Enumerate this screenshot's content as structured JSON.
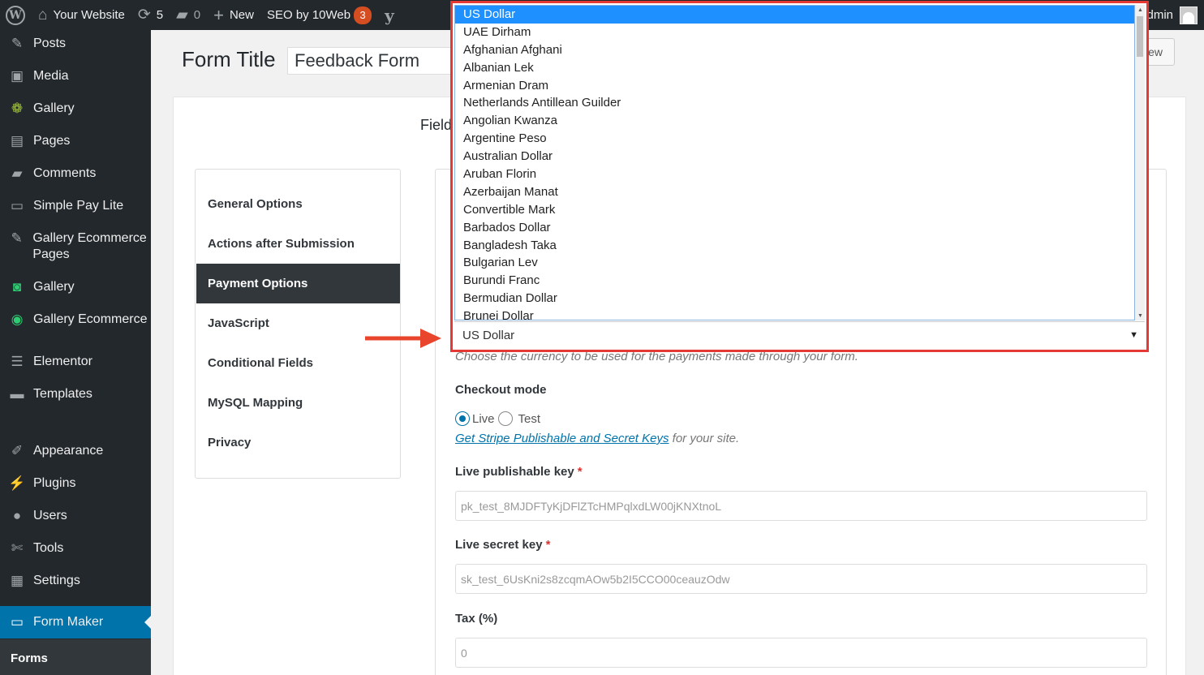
{
  "adminbar": {
    "site_name": "Your Website",
    "updates_count": "5",
    "comments_count": "0",
    "new_label": "New",
    "seo_label": "SEO by 10Web",
    "seo_badge": "3",
    "account_text": "dmin"
  },
  "sidebar": {
    "items": [
      {
        "label": "Posts",
        "icon": "pin-icon"
      },
      {
        "label": "Media",
        "icon": "media-icon"
      },
      {
        "label": "Gallery",
        "icon": "gallery-icon"
      },
      {
        "label": "Pages",
        "icon": "pages-icon"
      },
      {
        "label": "Comments",
        "icon": "comments-icon"
      },
      {
        "label": "Simple Pay Lite",
        "icon": "card-icon"
      },
      {
        "label": "Gallery Ecommerce Pages",
        "icon": "pin-icon"
      },
      {
        "label": "Gallery",
        "icon": "camera-icon"
      },
      {
        "label": "Gallery Ecommerce",
        "icon": "eye-icon"
      },
      {
        "label": "Elementor",
        "icon": "elementor-icon"
      },
      {
        "label": "Templates",
        "icon": "folder-icon"
      },
      {
        "label": "Appearance",
        "icon": "brush-icon"
      },
      {
        "label": "Plugins",
        "icon": "plug-icon"
      },
      {
        "label": "Users",
        "icon": "user-icon"
      },
      {
        "label": "Tools",
        "icon": "wrench-icon"
      },
      {
        "label": "Settings",
        "icon": "settings-icon"
      },
      {
        "label": "Form Maker",
        "icon": "keyboard-icon"
      }
    ],
    "submenu_current": "Forms"
  },
  "page": {
    "form_title_label": "Form Title",
    "form_title_value": "Feedback Form",
    "preview_button": "ew",
    "fields_tab": "Field"
  },
  "options_nav": [
    "General Options",
    "Actions after Submission",
    "Payment Options",
    "JavaScript",
    "Conditional Fields",
    "MySQL Mapping",
    "Privacy"
  ],
  "payment": {
    "currency_help": "Choose the currency to be used for the payments made through your form.",
    "checkout_mode_label": "Checkout mode",
    "live_label": "Live",
    "test_label": "Test",
    "stripe_link": "Get Stripe Publishable and Secret Keys",
    "stripe_link_suffix": "for your site.",
    "live_pub_key_label": "Live publishable key",
    "live_pub_key_value": "pk_test_8MJDFTyKjDFlZTcHMPqlxdLW00jKNXtnoL",
    "live_secret_key_label": "Live secret key",
    "live_secret_key_value": "sk_test_6UsKni2s8zcqmAOw5b2I5CCO00ceauzOdw",
    "tax_label": "Tax (%)",
    "tax_value": "0",
    "required_mark": "*"
  },
  "currency_dropdown": {
    "selected": "US Dollar",
    "options": [
      "US Dollar",
      "UAE Dirham",
      "Afghanian Afghani",
      "Albanian Lek",
      "Armenian Dram",
      "Netherlands Antillean Guilder",
      "Angolian Kwanza",
      "Argentine Peso",
      "Australian Dollar",
      "Aruban Florin",
      "Azerbaijan Manat",
      "Convertible Mark",
      "Barbados Dollar",
      "Bangladesh Taka",
      "Bulgarian Lev",
      "Burundi Franc",
      "Bermudian Dollar",
      "Brunei Dollar"
    ]
  },
  "colors": {
    "adminbar_bg": "#23282d",
    "accent": "#0073aa",
    "highlight_border": "#e53935",
    "selected_option": "#1e90ff"
  }
}
